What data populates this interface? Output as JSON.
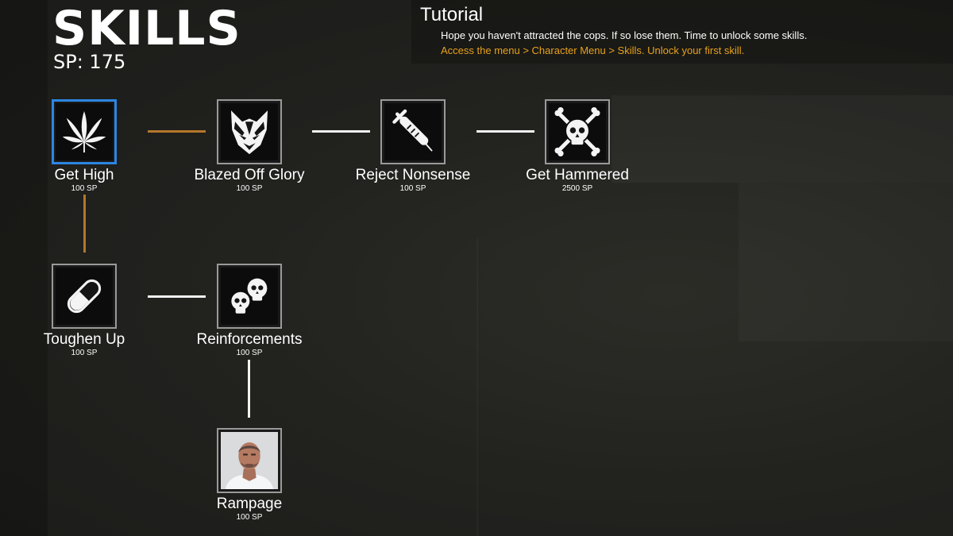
{
  "header": {
    "title": "SKILLS",
    "sp": "SP: 175"
  },
  "tutorial": {
    "title": "Tutorial",
    "text": "Hope you haven't attracted the cops. If so lose them. Time to unlock some skills.",
    "hint": "Access the menu > Character Menu > Skills. Unlock your first skill."
  },
  "skills": {
    "get_high": {
      "name": "Get High",
      "cost": "100 SP",
      "icon": "cannabis-leaf-icon",
      "selected": true
    },
    "blazed_off_glory": {
      "name": "Blazed Off Glory",
      "cost": "100 SP",
      "icon": "wolf-mask-icon"
    },
    "reject_nonsense": {
      "name": "Reject Nonsense",
      "cost": "100 SP",
      "icon": "syringe-icon"
    },
    "get_hammered": {
      "name": "Get Hammered",
      "cost": "2500 SP",
      "icon": "skull-crossbones-icon"
    },
    "toughen_up": {
      "name": "Toughen Up",
      "cost": "100 SP",
      "icon": "pill-icon"
    },
    "reinforcements": {
      "name": "Reinforcements",
      "cost": "100 SP",
      "icon": "two-skulls-icon"
    },
    "rampage": {
      "name": "Rampage",
      "cost": "100 SP",
      "icon": "character-portrait-icon"
    }
  },
  "colors": {
    "selected_border": "#2c86e3",
    "active_connector": "#b4772a",
    "inactive_connector": "#f2f2f2",
    "tutorial_hint": "#e7a21b"
  }
}
